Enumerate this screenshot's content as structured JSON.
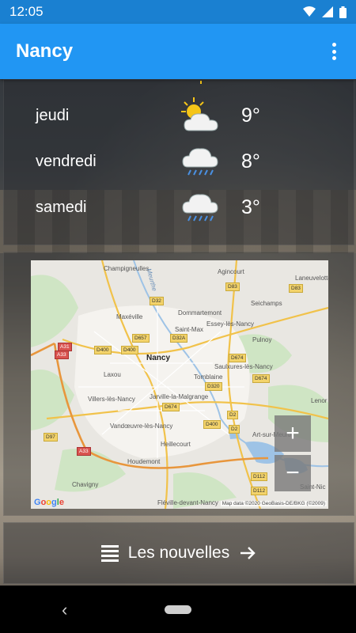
{
  "status": {
    "time": "12:05"
  },
  "app": {
    "title": "Nancy"
  },
  "forecast": [
    {
      "day": "jeudi",
      "temp": "9°",
      "icon": "sun-cloud-icon"
    },
    {
      "day": "vendredi",
      "temp": "8°",
      "icon": "rain-cloud-icon"
    },
    {
      "day": "samedi",
      "temp": "3°",
      "icon": "rain-cloud-icon"
    }
  ],
  "map": {
    "places": {
      "champigneulles": "Champigneulles",
      "agincourt": "Agincourt",
      "laneuvelotte": "Laneuvelotte",
      "seichamps": "Seichamps",
      "dommartemont": "Dommartemont",
      "maxeville": "Maxéville",
      "essey": "Essey-lès-Nancy",
      "saint_max": "Saint-Max",
      "pulnoy": "Pulnoy",
      "nancy": "Nancy",
      "saulxures": "Saulxures-lès-Nancy",
      "laxou": "Laxou",
      "tomblaine": "Tomblaine",
      "jarville": "Jarville-la-Malgrange",
      "villers": "Villers-lès-Nancy",
      "lenor": "Lenor",
      "vandoeuvre": "Vandœuvre-lès-Nancy",
      "heillecourt": "Heillecourt",
      "art_sur_meurthe": "Art-sur-Meurth",
      "houdemont": "Houdemont",
      "chavigny": "Chavigny",
      "fleville": "Fléville-devant-Nancy",
      "saint_nic": "Saint-Nic"
    },
    "roads": {
      "d83a": "D83",
      "d83b": "D83",
      "d32": "D32",
      "d657": "D657",
      "d32a": "D32A",
      "d400a": "D400",
      "d400b": "D400",
      "d674a": "D674",
      "d674b": "D674",
      "d674c": "D674",
      "d2a": "D2",
      "d2b": "D2",
      "d320": "D320",
      "d97": "D97",
      "d112a": "D112",
      "d112b": "D112",
      "a31": "A31",
      "a33a": "A33",
      "a33b": "A33"
    },
    "river_label": "Meurthe",
    "zoom_in": "+",
    "zoom_out": "−",
    "google": "Google",
    "attribution": "Map data ©2020 GeoBasis-DE/BKG (©2009)"
  },
  "news": {
    "label": "Les nouvelles",
    "icon": "list-icon",
    "arrow": "arrow-right-icon"
  },
  "colors": {
    "app_bar": "#2196f3",
    "status_bar": "#1a80d1"
  }
}
